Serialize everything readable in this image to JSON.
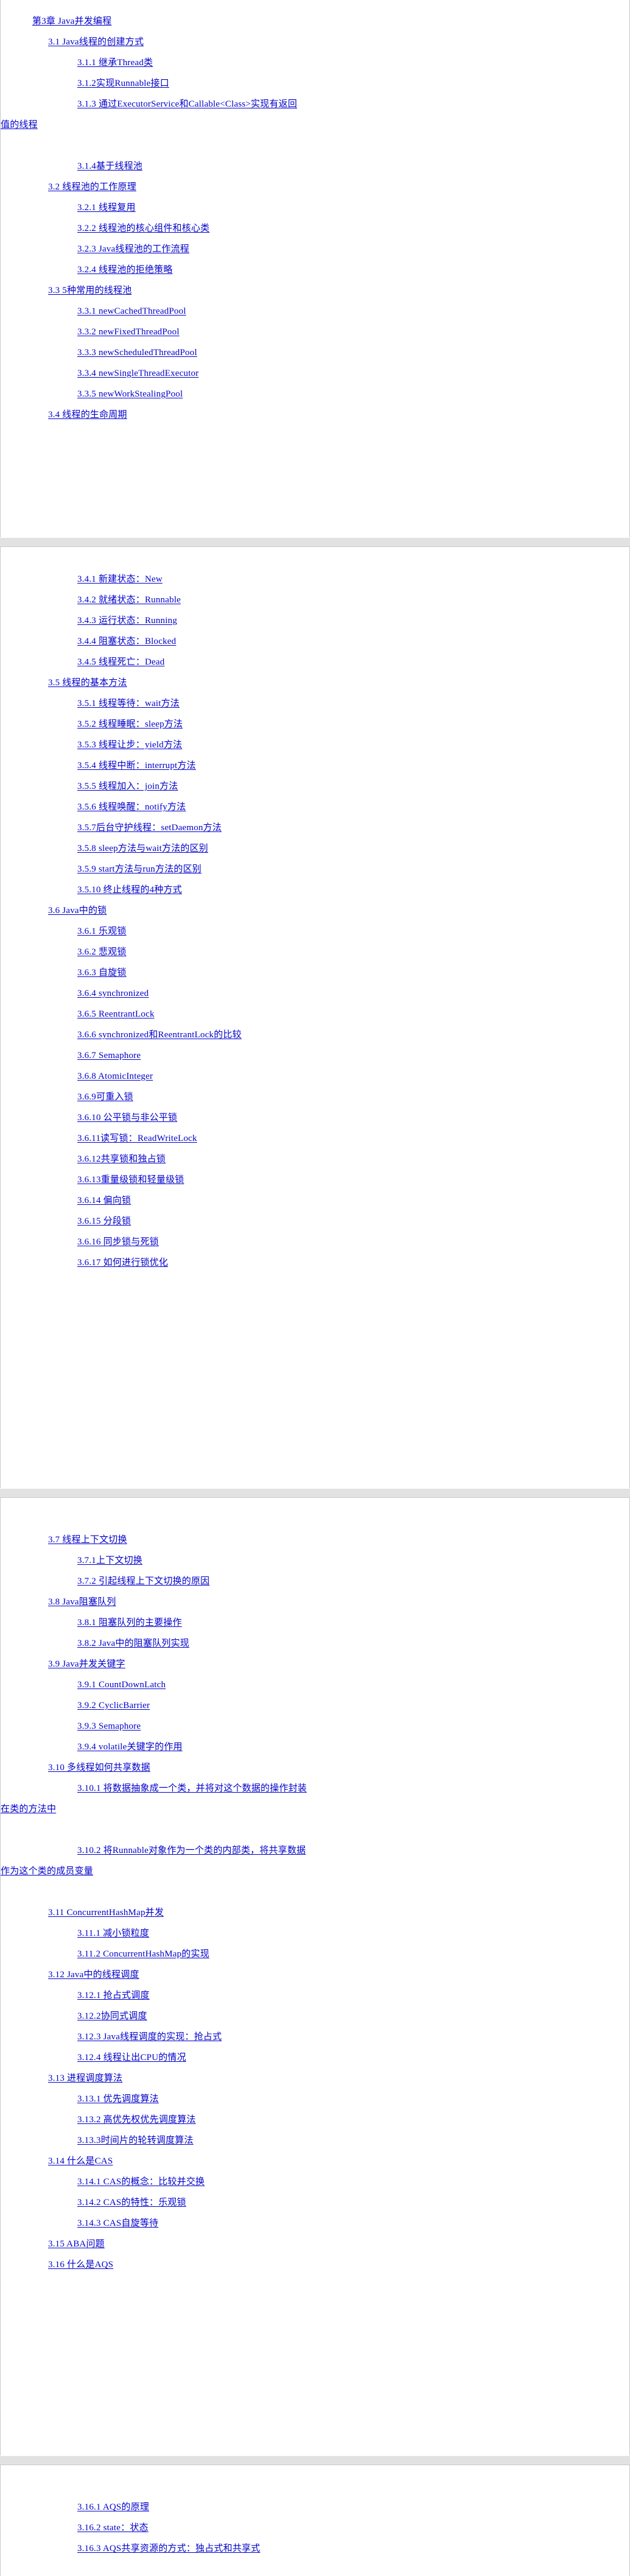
{
  "document": {
    "title": "第3章 Java并发编程",
    "link_color": "#0000CC",
    "pages": [
      {
        "page_index": 1,
        "entries": [
          {
            "level": 1,
            "text": "第3章 Java并发编程"
          },
          {
            "level": 2,
            "text": "3.1 Java线程的创建方式"
          },
          {
            "level": 3,
            "text": "3.1.1 继承Thread类"
          },
          {
            "level": 3,
            "text": "3.1.2实现Runnable接口"
          },
          {
            "level": 3,
            "text": "3.1.3 通过ExecutorService和Callable<Class>实现有返回",
            "cont": "值的线程"
          },
          {
            "level": 3,
            "text": "3.1.4基于线程池"
          },
          {
            "level": 2,
            "text": "3.2 线程池的工作原理"
          },
          {
            "level": 3,
            "text": "3.2.1 线程复用"
          },
          {
            "level": 3,
            "text": "3.2.2 线程池的核心组件和核心类"
          },
          {
            "level": 3,
            "text": "3.2.3 Java线程池的工作流程"
          },
          {
            "level": 3,
            "text": "3.2.4 线程池的拒绝策略"
          },
          {
            "level": 2,
            "text": "3.3 5种常用的线程池"
          },
          {
            "level": 3,
            "text": "3.3.1 newCachedThreadPool"
          },
          {
            "level": 3,
            "text": "3.3.2 newFixedThreadPool"
          },
          {
            "level": 3,
            "text": "3.3.3 newScheduledThreadPool"
          },
          {
            "level": 3,
            "text": "3.3.4 newSingleThreadExecutor"
          },
          {
            "level": 3,
            "text": "3.3.5 newWorkStealingPool"
          },
          {
            "level": 2,
            "text": "3.4 线程的生命周期"
          }
        ]
      },
      {
        "page_index": 2,
        "entries": [
          {
            "level": 3,
            "text": "3.4.1 新建状态：New"
          },
          {
            "level": 3,
            "text": "3.4.2 就绪状态：Runnable"
          },
          {
            "level": 3,
            "text": "3.4.3 运行状态：Running"
          },
          {
            "level": 3,
            "text": "3.4.4 阻塞状态：Blocked"
          },
          {
            "level": 3,
            "text": "3.4.5 线程死亡：Dead"
          },
          {
            "level": 2,
            "text": "3.5 线程的基本方法"
          },
          {
            "level": 3,
            "text": "3.5.1 线程等待：wait方法"
          },
          {
            "level": 3,
            "text": "3.5.2 线程睡眠：sleep方法"
          },
          {
            "level": 3,
            "text": "3.5.3 线程让步：yield方法"
          },
          {
            "level": 3,
            "text": "3.5.4 线程中断：interrupt方法"
          },
          {
            "level": 3,
            "text": "3.5.5 线程加入：join方法"
          },
          {
            "level": 3,
            "text": "3.5.6 线程唤醒：notify方法"
          },
          {
            "level": 3,
            "text": "3.5.7后台守护线程：setDaemon方法"
          },
          {
            "level": 3,
            "text": "3.5.8 sleep方法与wait方法的区别"
          },
          {
            "level": 3,
            "text": "3.5.9 start方法与run方法的区别"
          },
          {
            "level": 3,
            "text": "3.5.10 终止线程的4种方式"
          },
          {
            "level": 2,
            "text": "3.6 Java中的锁"
          },
          {
            "level": 3,
            "text": "3.6.1 乐观锁"
          },
          {
            "level": 3,
            "text": "3.6.2 悲观锁"
          },
          {
            "level": 3,
            "text": "3.6.3 自旋锁"
          },
          {
            "level": 3,
            "text": "3.6.4 synchronized"
          },
          {
            "level": 3,
            "text": "3.6.5 ReentrantLock"
          },
          {
            "level": 3,
            "text": "3.6.6 synchronized和ReentrantLock的比较"
          },
          {
            "level": 3,
            "text": "3.6.7 Semaphore"
          },
          {
            "level": 3,
            "text": "3.6.8 AtomicInteger"
          },
          {
            "level": 3,
            "text": "3.6.9可重入锁"
          },
          {
            "level": 3,
            "text": "3.6.10 公平锁与非公平锁"
          },
          {
            "level": 3,
            "text": "3.6.11读写锁：ReadWriteLock"
          },
          {
            "level": 3,
            "text": "3.6.12共享锁和独占锁"
          },
          {
            "level": 3,
            "text": "3.6.13重量级锁和轻量级锁"
          },
          {
            "level": 3,
            "text": "3.6.14 偏向锁"
          },
          {
            "level": 3,
            "text": "3.6.15 分段锁"
          },
          {
            "level": 3,
            "text": "3.6.16 同步锁与死锁"
          },
          {
            "level": 3,
            "text": "3.6.17 如何进行锁优化"
          }
        ]
      },
      {
        "page_index": 3,
        "entries": [
          {
            "level": 2,
            "text": "3.7 线程上下文切换"
          },
          {
            "level": 3,
            "text": "3.7.1上下文切换"
          },
          {
            "level": 3,
            "text": "3.7.2 引起线程上下文切换的原因"
          },
          {
            "level": 2,
            "text": "3.8 Java阻塞队列"
          },
          {
            "level": 3,
            "text": "3.8.1 阻塞队列的主要操作"
          },
          {
            "level": 3,
            "text": "3.8.2 Java中的阻塞队列实现"
          },
          {
            "level": 2,
            "text": "3.9 Java并发关键字"
          },
          {
            "level": 3,
            "text": "3.9.1 CountDownLatch"
          },
          {
            "level": 3,
            "text": "3.9.2 CyclicBarrier"
          },
          {
            "level": 3,
            "text": "3.9.3 Semaphore"
          },
          {
            "level": 3,
            "text": "3.9.4 volatile关键字的作用"
          },
          {
            "level": 2,
            "text": "3.10 多线程如何共享数据"
          },
          {
            "level": 3,
            "text": "3.10.1 将数据抽象成一个类，并将对这个数据的操作封装",
            "cont": "在类的方法中"
          },
          {
            "level": 3,
            "text": "3.10.2 将Runnable对象作为一个类的内部类，将共享数据",
            "cont": "作为这个类的成员变量"
          },
          {
            "level": 2,
            "text": "3.11 ConcurrentHashMap并发"
          },
          {
            "level": 3,
            "text": "3.11.1 减小锁粒度"
          },
          {
            "level": 3,
            "text": "3.11.2 ConcurrentHashMap的实现"
          },
          {
            "level": 2,
            "text": "3.12 Java中的线程调度"
          },
          {
            "level": 3,
            "text": "3.12.1 抢占式调度"
          },
          {
            "level": 3,
            "text": "3.12.2协同式调度"
          },
          {
            "level": 3,
            "text": "3.12.3 Java线程调度的实现：抢占式"
          },
          {
            "level": 3,
            "text": "3.12.4 线程让出CPU的情况"
          },
          {
            "level": 2,
            "text": "3.13 进程调度算法"
          },
          {
            "level": 3,
            "text": "3.13.1 优先调度算法"
          },
          {
            "level": 3,
            "text": "3.13.2 高优先权优先调度算法"
          },
          {
            "level": 3,
            "text": "3.13.3时间片的轮转调度算法"
          },
          {
            "level": 2,
            "text": "3.14 什么是CAS"
          },
          {
            "level": 3,
            "text": "3.14.1 CAS的概念：比较并交换"
          },
          {
            "level": 3,
            "text": "3.14.2 CAS的特性：乐观锁"
          },
          {
            "level": 3,
            "text": "3.14.3 CAS自旋等待"
          },
          {
            "level": 2,
            "text": "3.15 ABA问题"
          },
          {
            "level": 2,
            "text": "3.16 什么是AQS"
          }
        ]
      },
      {
        "page_index": 4,
        "entries": [
          {
            "level": 3,
            "text": "3.16.1 AQS的原理"
          },
          {
            "level": 3,
            "text": "3.16.2 state：状态"
          },
          {
            "level": 3,
            "text": "3.16.3 AQS共享资源的方式：独占式和共享式"
          }
        ]
      }
    ]
  }
}
